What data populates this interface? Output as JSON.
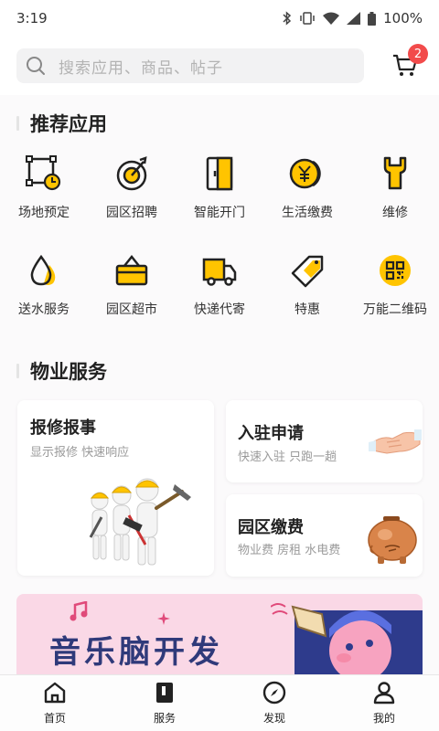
{
  "status": {
    "time": "3:19",
    "battery": "100%"
  },
  "search": {
    "placeholder": "搜索应用、商品、帖子"
  },
  "cart": {
    "badge": "2"
  },
  "sections": {
    "recommended_title": "推荐应用",
    "property_title": "物业服务"
  },
  "apps": [
    {
      "label": "场地预定",
      "icon": "venue-booking-icon"
    },
    {
      "label": "园区招聘",
      "icon": "recruit-target-icon"
    },
    {
      "label": "智能开门",
      "icon": "smart-door-icon"
    },
    {
      "label": "生活缴费",
      "icon": "yen-coin-icon"
    },
    {
      "label": "维修",
      "icon": "wrench-icon"
    },
    {
      "label": "送水服务",
      "icon": "water-drop-icon"
    },
    {
      "label": "园区超市",
      "icon": "shopping-basket-icon"
    },
    {
      "label": "快递代寄",
      "icon": "delivery-truck-icon"
    },
    {
      "label": "特惠",
      "icon": "discount-tag-icon"
    },
    {
      "label": "万能二维码",
      "icon": "qr-code-icon"
    }
  ],
  "property": {
    "repair": {
      "title": "报修报事",
      "subtitle": "显示报修 快速响应"
    },
    "settle": {
      "title": "入驻申请",
      "subtitle": "快速入驻 只跑一趟"
    },
    "fees": {
      "title": "园区缴费",
      "subtitle": "物业费 房租 水电费"
    }
  },
  "banner": {
    "text": "音乐脑开发"
  },
  "nav": [
    {
      "label": "首页",
      "icon": "home-icon"
    },
    {
      "label": "服务",
      "icon": "service-book-icon"
    },
    {
      "label": "发现",
      "icon": "compass-icon"
    },
    {
      "label": "我的",
      "icon": "profile-icon"
    }
  ],
  "colors": {
    "accent": "#ffc400",
    "icon_stroke": "#222222",
    "badge": "#f24b4b",
    "banner_bg": "#fad8e6"
  }
}
